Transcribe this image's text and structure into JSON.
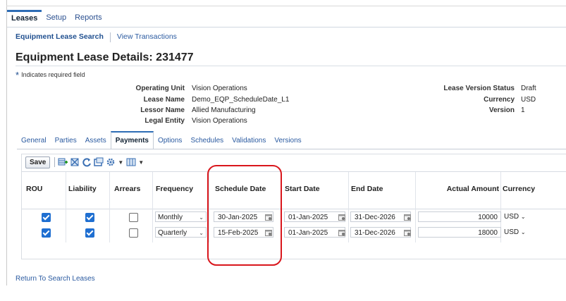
{
  "top_tabs": [
    {
      "label": "Leases",
      "active": true
    },
    {
      "label": "Setup",
      "active": false
    },
    {
      "label": "Reports",
      "active": false
    }
  ],
  "sub_nav": {
    "primary": "Equipment Lease Search",
    "secondary": "View Transactions"
  },
  "page_title": "Equipment Lease Details: 231477",
  "required_note": "Indicates required field",
  "header_fields_left": [
    {
      "label": "Operating Unit",
      "value": "Vision Operations"
    },
    {
      "label": "Lease Name",
      "value": "Demo_EQP_ScheduleDate_L1"
    },
    {
      "label": "Lessor Name",
      "value": "Allied Manufacturing"
    },
    {
      "label": "Legal Entity",
      "value": "Vision Operations"
    }
  ],
  "header_fields_right": [
    {
      "label": "Lease Version Status",
      "value": "Draft"
    },
    {
      "label": "Currency",
      "value": "USD"
    },
    {
      "label": "Version",
      "value": "1"
    }
  ],
  "detail_tabs": [
    "General",
    "Parties",
    "Assets",
    "Payments",
    "Options",
    "Schedules",
    "Validations",
    "Versions"
  ],
  "active_detail_tab": "Payments",
  "toolbar": {
    "save_label": "Save"
  },
  "columns": [
    "ROU",
    "Liability",
    "Arrears",
    "Frequency",
    "Schedule Date",
    "Start Date",
    "End Date",
    "Actual Amount",
    "Currency"
  ],
  "rows": [
    {
      "rou": true,
      "liability": true,
      "arrears": false,
      "frequency": "Monthly",
      "schedule_date": "30-Jan-2025",
      "start_date": "01-Jan-2025",
      "end_date": "31-Dec-2026",
      "actual_amount": "10000",
      "currency": "USD"
    },
    {
      "rou": true,
      "liability": true,
      "arrears": false,
      "frequency": "Quarterly",
      "schedule_date": "15-Feb-2025",
      "start_date": "01-Jan-2025",
      "end_date": "31-Dec-2026",
      "actual_amount": "18000",
      "currency": "USD"
    }
  ],
  "footer_link": "Return To Search Leases",
  "colors": {
    "accent": "#2d6db5",
    "link": "#2a5aa0",
    "highlight": "#d9161c",
    "checkbox": "#1f6fd1"
  },
  "icons": [
    "add-row-icon",
    "delete-row-icon",
    "refresh-icon",
    "detach-icon",
    "settings-icon",
    "columns-icon",
    "calendar-icon",
    "chevron-down-icon"
  ]
}
